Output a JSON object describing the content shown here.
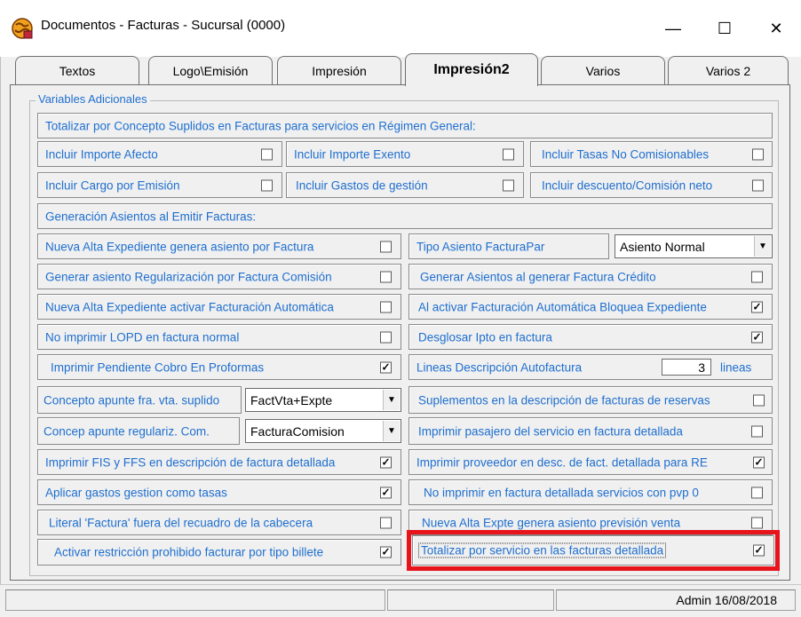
{
  "window": {
    "title": "Documentos - Facturas - Sucursal (0000)",
    "app_icon": "app-globe-icon",
    "controls": {
      "minimize": "—",
      "maximize": "☐",
      "close": "✕"
    }
  },
  "tabs": [
    {
      "label": "Textos",
      "active": false
    },
    {
      "label": "Logo\\Emisión",
      "active": false
    },
    {
      "label": "Impresión",
      "active": false
    },
    {
      "label": "Impresión2",
      "active": true
    },
    {
      "label": "Varios",
      "active": false
    },
    {
      "label": "Varios 2",
      "active": false
    }
  ],
  "group": {
    "legend": "Variables Adicionales",
    "section1": "Totalizar por Concepto Suplidos en Facturas para servicios en Régimen General:",
    "section2": "Generación Asientos al Emitir Facturas:",
    "row1": [
      {
        "label": "Incluir Importe Afecto",
        "checked": false
      },
      {
        "label": "Incluir Importe Exento",
        "checked": false
      },
      {
        "label": "Incluir Tasas No Comisionables",
        "checked": false
      }
    ],
    "row2": [
      {
        "label": "Incluir Cargo por Emisión",
        "checked": false
      },
      {
        "label": "Incluir Gastos de gestión",
        "checked": false
      },
      {
        "label": "Incluir descuento/Comisión neto",
        "checked": false
      }
    ],
    "left": [
      {
        "label": "Nueva Alta Expediente genera asiento por Factura",
        "checked": false
      },
      {
        "label": "Generar asiento Regularización por Factura Comisión",
        "checked": false
      },
      {
        "label": "Nueva Alta Expediente activar Facturación Automática",
        "checked": false
      },
      {
        "label": "No imprimir LOPD en factura normal",
        "checked": false
      },
      {
        "label": "Imprimir Pendiente Cobro En Proformas",
        "checked": true
      },
      {
        "label": "Concepto apunte fra. vta. suplido",
        "combo": "FactVta+Expte"
      },
      {
        "label": "Concep apunte regulariz. Com.",
        "combo": "FacturaComision"
      },
      {
        "label": "Imprimir FIS y FFS en descripción de factura detallada",
        "checked": true
      },
      {
        "label": "Aplicar gastos gestion como tasas",
        "checked": true
      },
      {
        "label": "Literal 'Factura' fuera del recuadro de la cabecera",
        "checked": false
      },
      {
        "label": "Activar restricción prohibido facturar por tipo billete",
        "checked": true
      }
    ],
    "right": [
      {
        "label": "Tipo Asiento FacturaPar",
        "combo": "Asiento Normal"
      },
      {
        "label": "Generar Asientos al generar Factura Crédito",
        "checked": false
      },
      {
        "label": "Al activar Facturación Automática Bloquea Expediente",
        "checked": true
      },
      {
        "label": "Desglosar Ipto en  factura",
        "checked": true
      },
      {
        "label": "Lineas Descripción Autofactura",
        "number": "3",
        "suffix": "lineas"
      },
      {
        "label": "Suplementos en la descripción de facturas de reservas",
        "checked": false
      },
      {
        "label": "Imprimir pasajero del servicio en factura detallada",
        "checked": false
      },
      {
        "label": "Imprimir proveedor en desc. de fact. detallada para RE",
        "checked": true
      },
      {
        "label": "No imprimir en factura detallada servicios con  pvp 0",
        "checked": false
      },
      {
        "label": "Nueva Alta Expte genera asiento previsión venta",
        "checked": false
      },
      {
        "label": "Totalizar por servicio en las facturas detallada",
        "checked": true
      }
    ]
  },
  "statusbar": {
    "text": "Admin 16/08/2018"
  },
  "colors": {
    "label": "#1f6fcf",
    "highlight": "#e8141c",
    "face": "#f0f0f0"
  }
}
